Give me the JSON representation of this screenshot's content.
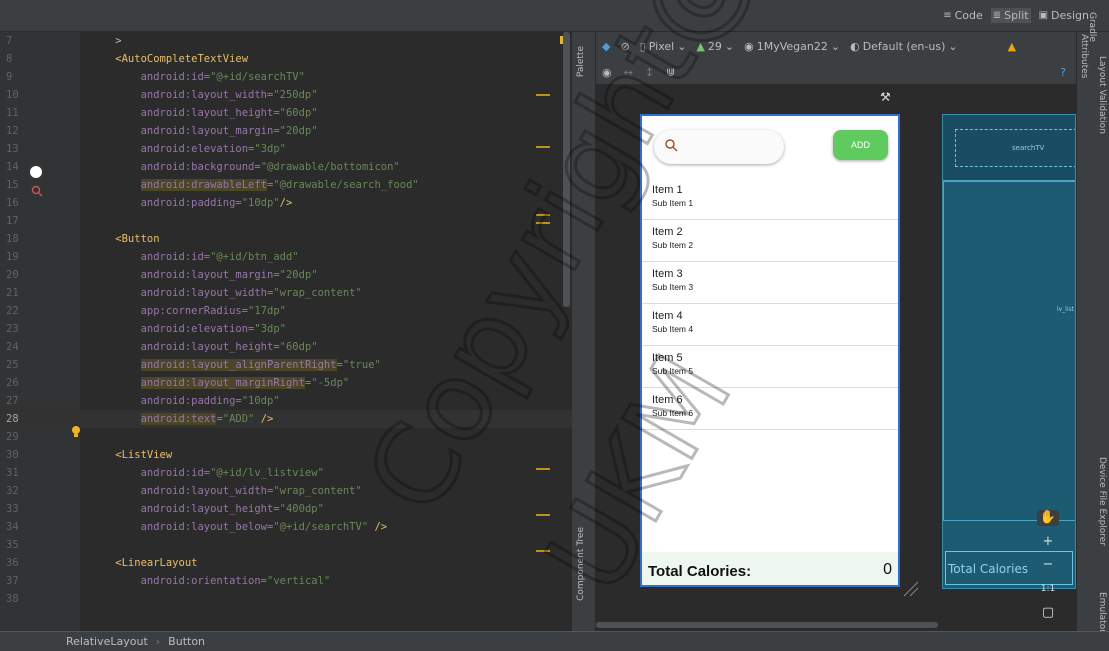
{
  "view_modes": {
    "code": "Code",
    "split": "Split",
    "design": "Design",
    "active": "Split"
  },
  "editor": {
    "current_line": 28,
    "lines": [
      {
        "n": "7",
        "segs": [
          {
            "c": "pl",
            "t": "    >"
          }
        ]
      },
      {
        "n": "8",
        "segs": [
          {
            "c": "tag",
            "t": "    <AutoCompleteTextView"
          }
        ]
      },
      {
        "n": "9",
        "segs": [
          {
            "c": "attr",
            "t": "        android:id="
          },
          {
            "c": "val",
            "t": "\"@+id/searchTV\""
          }
        ]
      },
      {
        "n": "10",
        "segs": [
          {
            "c": "attr",
            "t": "        android:layout_width="
          },
          {
            "c": "val",
            "t": "\"250dp\""
          }
        ]
      },
      {
        "n": "11",
        "segs": [
          {
            "c": "attr",
            "t": "        android:layout_height="
          },
          {
            "c": "val",
            "t": "\"60dp\""
          }
        ]
      },
      {
        "n": "12",
        "segs": [
          {
            "c": "attr",
            "t": "        android:layout_margin="
          },
          {
            "c": "val",
            "t": "\"20dp\""
          }
        ]
      },
      {
        "n": "13",
        "segs": [
          {
            "c": "attr",
            "t": "        android:elevation="
          },
          {
            "c": "val",
            "t": "\"3dp\""
          }
        ]
      },
      {
        "n": "14",
        "segs": [
          {
            "c": "attr",
            "t": "        android:background="
          },
          {
            "c": "val",
            "t": "\"@drawable/bottomicon\""
          }
        ]
      },
      {
        "n": "15",
        "segs": [
          {
            "c": "pl",
            "t": "        "
          },
          {
            "c": "attr hl",
            "t": "android:drawableLeft"
          },
          {
            "c": "attr",
            "t": "="
          },
          {
            "c": "val",
            "t": "\"@drawable/search_food\""
          }
        ]
      },
      {
        "n": "16",
        "segs": [
          {
            "c": "attr",
            "t": "        android:padding="
          },
          {
            "c": "val",
            "t": "\"10dp\""
          },
          {
            "c": "tag",
            "t": "/>"
          }
        ]
      },
      {
        "n": "17",
        "segs": []
      },
      {
        "n": "18",
        "segs": [
          {
            "c": "tag",
            "t": "    <Button"
          }
        ]
      },
      {
        "n": "19",
        "segs": [
          {
            "c": "attr",
            "t": "        android:id="
          },
          {
            "c": "val",
            "t": "\"@+id/btn_add\""
          }
        ]
      },
      {
        "n": "20",
        "segs": [
          {
            "c": "attr",
            "t": "        android:layout_margin="
          },
          {
            "c": "val",
            "t": "\"20dp\""
          }
        ]
      },
      {
        "n": "21",
        "segs": [
          {
            "c": "attr",
            "t": "        android:layout_width="
          },
          {
            "c": "val",
            "t": "\"wrap_content\""
          }
        ]
      },
      {
        "n": "22",
        "segs": [
          {
            "c": "attr",
            "t": "        app:cornerRadius="
          },
          {
            "c": "val",
            "t": "\"17dp\""
          }
        ]
      },
      {
        "n": "23",
        "segs": [
          {
            "c": "attr",
            "t": "        android:elevation="
          },
          {
            "c": "val",
            "t": "\"3dp\""
          }
        ]
      },
      {
        "n": "24",
        "segs": [
          {
            "c": "attr",
            "t": "        android:layout_height="
          },
          {
            "c": "val",
            "t": "\"60dp\""
          }
        ]
      },
      {
        "n": "25",
        "segs": [
          {
            "c": "pl",
            "t": "        "
          },
          {
            "c": "attr hl",
            "t": "android:layout_alignParentRight"
          },
          {
            "c": "attr",
            "t": "="
          },
          {
            "c": "val",
            "t": "\"true\""
          }
        ]
      },
      {
        "n": "26",
        "segs": [
          {
            "c": "pl",
            "t": "        "
          },
          {
            "c": "attr hl",
            "t": "android:layout_marginRight"
          },
          {
            "c": "attr",
            "t": "="
          },
          {
            "c": "val",
            "t": "\"-5dp\""
          }
        ]
      },
      {
        "n": "27",
        "segs": [
          {
            "c": "attr",
            "t": "        android:padding="
          },
          {
            "c": "val",
            "t": "\"10dp\""
          }
        ]
      },
      {
        "n": "28",
        "segs": [
          {
            "c": "pl",
            "t": "        "
          },
          {
            "c": "attr hl",
            "t": "android:text"
          },
          {
            "c": "attr",
            "t": "="
          },
          {
            "c": "val",
            "t": "\"ADD\""
          },
          {
            "c": "pl",
            "t": " "
          },
          {
            "c": "tag",
            "t": "/>"
          }
        ]
      },
      {
        "n": "29",
        "segs": []
      },
      {
        "n": "30",
        "segs": [
          {
            "c": "tag",
            "t": "    <ListView"
          }
        ]
      },
      {
        "n": "31",
        "segs": [
          {
            "c": "attr",
            "t": "        android:id="
          },
          {
            "c": "val",
            "t": "\"@+id/lv_listview\""
          }
        ]
      },
      {
        "n": "32",
        "segs": [
          {
            "c": "attr",
            "t": "        android:layout_width="
          },
          {
            "c": "val",
            "t": "\"wrap_content\""
          }
        ]
      },
      {
        "n": "33",
        "segs": [
          {
            "c": "attr",
            "t": "        android:layout_height="
          },
          {
            "c": "val",
            "t": "\"400dp\""
          }
        ]
      },
      {
        "n": "34",
        "segs": [
          {
            "c": "attr",
            "t": "        android:layout_below="
          },
          {
            "c": "val",
            "t": "\"@+id/searchTV\""
          },
          {
            "c": "pl",
            "t": " "
          },
          {
            "c": "tag",
            "t": "/>"
          }
        ]
      },
      {
        "n": "35",
        "segs": []
      },
      {
        "n": "36",
        "segs": [
          {
            "c": "tag",
            "t": "    <LinearLayout"
          }
        ]
      },
      {
        "n": "37",
        "segs": [
          {
            "c": "attr",
            "t": "        android:orientation="
          },
          {
            "c": "val",
            "t": "\"vertical\""
          }
        ]
      },
      {
        "n": "38",
        "segs": []
      }
    ]
  },
  "left_tabs": {
    "palette": "Palette",
    "component_tree": "Component Tree"
  },
  "right_tabs": {
    "attributes": "Attributes",
    "layout_validation": "Layout Validation",
    "device_file_explorer": "Device File Explorer",
    "emulator": "Emulator",
    "gradle": "Gradle"
  },
  "design_toolbar": {
    "device": "Pixel",
    "api": "29",
    "theme": "1MyVegan22",
    "locale": "Default (en-us)"
  },
  "preview": {
    "add_label": "ADD",
    "items": [
      {
        "title": "Item 1",
        "sub": "Sub Item 1"
      },
      {
        "title": "Item 2",
        "sub": "Sub Item 2"
      },
      {
        "title": "Item 3",
        "sub": "Sub Item 3"
      },
      {
        "title": "Item 4",
        "sub": "Sub Item 4"
      },
      {
        "title": "Item 5",
        "sub": "Sub Item 5"
      },
      {
        "title": "Item 6",
        "sub": "Sub Item 6"
      }
    ],
    "total_label": "Total Calories:",
    "total_value": "0"
  },
  "blueprint": {
    "search_label": "searchTV",
    "list_label": "lv_list",
    "total_label": "Total Calories"
  },
  "zoom": {
    "plus": "+",
    "minus": "−",
    "ratio": "1:1"
  },
  "breadcrumb": {
    "root": "RelativeLayout",
    "child": "Button"
  },
  "watermark": {
    "lines": [
      "Copyright@FTSM",
      "UKM"
    ]
  }
}
